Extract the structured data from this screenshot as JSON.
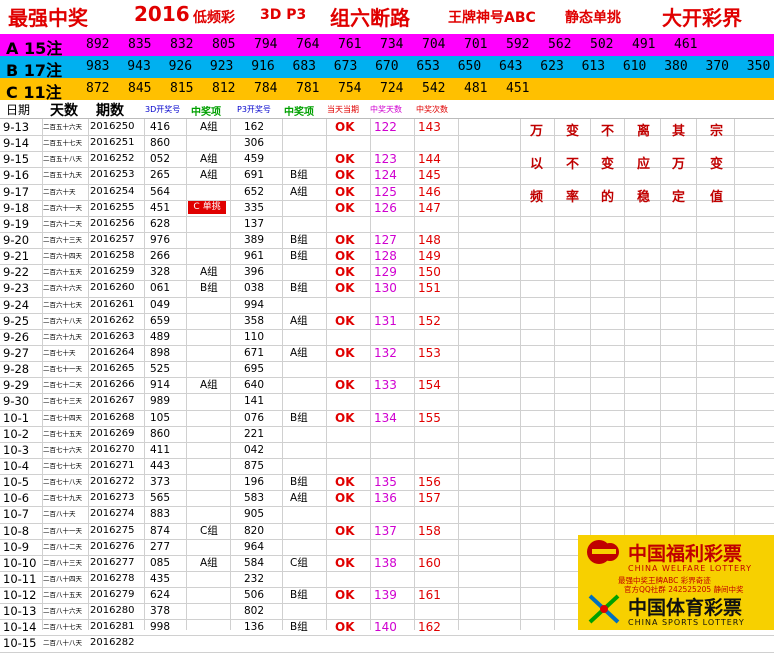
{
  "title": {
    "parts": [
      "最强中奖",
      "2016",
      "低频彩",
      "3D P3",
      "组六断路",
      "王牌神号ABC",
      "静态单挑",
      "大开彩界"
    ]
  },
  "bands": [
    {
      "label": "A 15注",
      "color": "#ff00ff",
      "numbers": [
        "892",
        "835",
        "832",
        "805",
        "794",
        "764",
        "761",
        "734",
        "704",
        "701",
        "592",
        "562",
        "502",
        "491",
        "461"
      ]
    },
    {
      "label": "B 17注",
      "color": "#00b0f0",
      "numbers": [
        "983",
        "943",
        "926",
        "923",
        "916",
        "683",
        "673",
        "670",
        "653",
        "650",
        "643",
        "623",
        "613",
        "610",
        "380",
        "370",
        "350"
      ]
    },
    {
      "label": "C 11注",
      "color": "#ffc000",
      "numbers": [
        "872",
        "845",
        "815",
        "812",
        "784",
        "781",
        "754",
        "724",
        "542",
        "481",
        "451"
      ]
    }
  ],
  "header": {
    "date": "日期",
    "day": "天数",
    "issue": "期数",
    "draw3d": "3D开奖号",
    "win1": "中奖项",
    "p3": "P3开奖号",
    "win2": "中奖项",
    "hit": "当天当期",
    "win_days": "中奖天数",
    "win_count": "中奖次数"
  },
  "rows": [
    {
      "date": "9-13",
      "day": "二百五十六天",
      "issue": "2016250",
      "draw": "416",
      "win": "A组",
      "p3": "162",
      "grp": "",
      "ok": "OK",
      "wd": "122",
      "wc": "143"
    },
    {
      "date": "9-14",
      "day": "二百五十七天",
      "issue": "2016251",
      "draw": "860",
      "win": "",
      "p3": "306",
      "grp": "",
      "ok": "",
      "wd": "",
      "wc": ""
    },
    {
      "date": "9-15",
      "day": "二百五十八天",
      "issue": "2016252",
      "draw": "052",
      "win": "A组",
      "p3": "459",
      "grp": "",
      "ok": "OK",
      "wd": "123",
      "wc": "144"
    },
    {
      "date": "9-16",
      "day": "二百五十九天",
      "issue": "2016253",
      "draw": "265",
      "win": "A组",
      "p3": "691",
      "grp": "B组",
      "ok": "OK",
      "wd": "124",
      "wc": "145"
    },
    {
      "date": "9-17",
      "day": "二百六十天",
      "issue": "2016254",
      "draw": "564",
      "win": "",
      "p3": "652",
      "grp": "A组",
      "ok": "OK",
      "wd": "125",
      "wc": "146"
    },
    {
      "date": "9-18",
      "day": "二百六十一天",
      "issue": "2016255",
      "draw": "451",
      "win": "C 单挑",
      "p3": "335",
      "grp": "",
      "ok": "OK",
      "wd": "126",
      "wc": "147"
    },
    {
      "date": "9-19",
      "day": "二百六十二天",
      "issue": "2016256",
      "draw": "628",
      "win": "",
      "p3": "137",
      "grp": "",
      "ok": "",
      "wd": "",
      "wc": ""
    },
    {
      "date": "9-20",
      "day": "二百六十三天",
      "issue": "2016257",
      "draw": "976",
      "win": "",
      "p3": "389",
      "grp": "B组",
      "ok": "OK",
      "wd": "127",
      "wc": "148"
    },
    {
      "date": "9-21",
      "day": "二百六十四天",
      "issue": "2016258",
      "draw": "266",
      "win": "",
      "p3": "961",
      "grp": "B组",
      "ok": "OK",
      "wd": "128",
      "wc": "149"
    },
    {
      "date": "9-22",
      "day": "二百六十五天",
      "issue": "2016259",
      "draw": "328",
      "win": "A组",
      "p3": "396",
      "grp": "",
      "ok": "OK",
      "wd": "129",
      "wc": "150"
    },
    {
      "date": "9-23",
      "day": "二百六十六天",
      "issue": "2016260",
      "draw": "061",
      "win": "B组",
      "p3": "038",
      "grp": "B组",
      "ok": "OK",
      "wd": "130",
      "wc": "151"
    },
    {
      "date": "9-24",
      "day": "二百六十七天",
      "issue": "2016261",
      "draw": "049",
      "win": "",
      "p3": "994",
      "grp": "",
      "ok": "",
      "wd": "",
      "wc": ""
    },
    {
      "date": "9-25",
      "day": "二百六十八天",
      "issue": "2016262",
      "draw": "659",
      "win": "",
      "p3": "358",
      "grp": "A组",
      "ok": "OK",
      "wd": "131",
      "wc": "152"
    },
    {
      "date": "9-26",
      "day": "二百六十九天",
      "issue": "2016263",
      "draw": "489",
      "win": "",
      "p3": "110",
      "grp": "",
      "ok": "",
      "wd": "",
      "wc": ""
    },
    {
      "date": "9-27",
      "day": "二百七十天",
      "issue": "2016264",
      "draw": "898",
      "win": "",
      "p3": "671",
      "grp": "A组",
      "ok": "OK",
      "wd": "132",
      "wc": "153"
    },
    {
      "date": "9-28",
      "day": "二百七十一天",
      "issue": "2016265",
      "draw": "525",
      "win": "",
      "p3": "695",
      "grp": "",
      "ok": "",
      "wd": "",
      "wc": ""
    },
    {
      "date": "9-29",
      "day": "二百七十二天",
      "issue": "2016266",
      "draw": "914",
      "win": "A组",
      "p3": "640",
      "grp": "",
      "ok": "OK",
      "wd": "133",
      "wc": "154"
    },
    {
      "date": "9-30",
      "day": "二百七十三天",
      "issue": "2016267",
      "draw": "989",
      "win": "",
      "p3": "141",
      "grp": "",
      "ok": "",
      "wd": "",
      "wc": ""
    },
    {
      "date": "10-1",
      "day": "二百七十四天",
      "issue": "2016268",
      "draw": "105",
      "win": "",
      "p3": "076",
      "grp": "B组",
      "ok": "OK",
      "wd": "134",
      "wc": "155"
    },
    {
      "date": "10-2",
      "day": "二百七十五天",
      "issue": "2016269",
      "draw": "860",
      "win": "",
      "p3": "221",
      "grp": "",
      "ok": "",
      "wd": "",
      "wc": ""
    },
    {
      "date": "10-3",
      "day": "二百七十六天",
      "issue": "2016270",
      "draw": "411",
      "win": "",
      "p3": "042",
      "grp": "",
      "ok": "",
      "wd": "",
      "wc": ""
    },
    {
      "date": "10-4",
      "day": "二百七十七天",
      "issue": "2016271",
      "draw": "443",
      "win": "",
      "p3": "875",
      "grp": "",
      "ok": "",
      "wd": "",
      "wc": ""
    },
    {
      "date": "10-5",
      "day": "二百七十八天",
      "issue": "2016272",
      "draw": "373",
      "win": "",
      "p3": "196",
      "grp": "B组",
      "ok": "OK",
      "wd": "135",
      "wc": "156"
    },
    {
      "date": "10-6",
      "day": "二百七十九天",
      "issue": "2016273",
      "draw": "565",
      "win": "",
      "p3": "583",
      "grp": "A组",
      "ok": "OK",
      "wd": "136",
      "wc": "157"
    },
    {
      "date": "10-7",
      "day": "二百八十天",
      "issue": "2016274",
      "draw": "883",
      "win": "",
      "p3": "905",
      "grp": "",
      "ok": "",
      "wd": "",
      "wc": ""
    },
    {
      "date": "10-8",
      "day": "二百八十一天",
      "issue": "2016275",
      "draw": "874",
      "win": "C组",
      "p3": "820",
      "grp": "",
      "ok": "OK",
      "wd": "137",
      "wc": "158"
    },
    {
      "date": "10-9",
      "day": "二百八十二天",
      "issue": "2016276",
      "draw": "277",
      "win": "",
      "p3": "964",
      "grp": "",
      "ok": "",
      "wd": "",
      "wc": ""
    },
    {
      "date": "10-10",
      "day": "二百八十三天",
      "issue": "2016277",
      "draw": "085",
      "win": "A组",
      "p3": "584",
      "grp": "C组",
      "ok": "OK",
      "wd": "138",
      "wc": "160"
    },
    {
      "date": "10-11",
      "day": "二百八十四天",
      "issue": "2016278",
      "draw": "435",
      "win": "",
      "p3": "232",
      "grp": "",
      "ok": "",
      "wd": "",
      "wc": ""
    },
    {
      "date": "10-12",
      "day": "二百八十五天",
      "issue": "2016279",
      "draw": "624",
      "win": "",
      "p3": "506",
      "grp": "B组",
      "ok": "OK",
      "wd": "139",
      "wc": "161"
    },
    {
      "date": "10-13",
      "day": "二百八十六天",
      "issue": "2016280",
      "draw": "378",
      "win": "",
      "p3": "802",
      "grp": "",
      "ok": "",
      "wd": "",
      "wc": ""
    },
    {
      "date": "10-14",
      "day": "二百八十七天",
      "issue": "2016281",
      "draw": "998",
      "win": "",
      "p3": "136",
      "grp": "B组",
      "ok": "OK",
      "wd": "140",
      "wc": "162"
    },
    {
      "date": "10-15",
      "day": "二百八十八天",
      "issue": "2016282",
      "draw": "",
      "win": "",
      "p3": "",
      "grp": "",
      "ok": "",
      "wd": "",
      "wc": ""
    }
  ],
  "quote": [
    "万",
    "变",
    "不",
    "离",
    "其",
    "宗",
    "以",
    "不",
    "变",
    "应",
    "万",
    "变",
    "频",
    "率",
    "的",
    "稳",
    "定",
    "值"
  ],
  "logo": {
    "welfare_cn": "中国福利彩票",
    "welfare_en": "CHINA WELFARE LOTTERY",
    "line1": "最强中奖王牌ABC 彩界奇迹",
    "line2": "官方QQ社群 242525205 静间中奖",
    "sports_cn": "中国体育彩票",
    "sports_en": "CHINA SPORTS LOTTERY"
  }
}
